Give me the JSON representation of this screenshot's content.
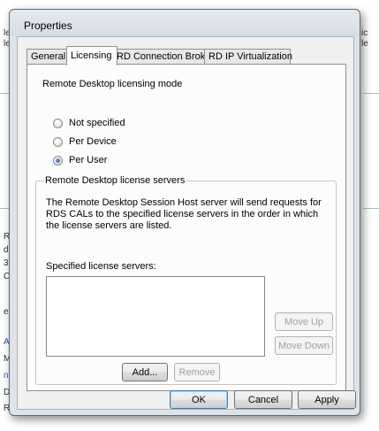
{
  "window": {
    "title": "Properties"
  },
  "tabs": [
    {
      "label": "General",
      "active": false
    },
    {
      "label": "Licensing",
      "active": true
    },
    {
      "label": "RD Connection Broker",
      "active": false
    },
    {
      "label": "RD IP Virtualization",
      "active": false
    }
  ],
  "licensing": {
    "mode_label": "Remote Desktop licensing mode",
    "modes": [
      {
        "label": "Not specified",
        "checked": false
      },
      {
        "label": "Per Device",
        "checked": false
      },
      {
        "label": "Per User",
        "checked": true
      }
    ],
    "servers_group": {
      "legend": "Remote Desktop license servers",
      "description": "The Remote Desktop Session Host server will send requests for RDS CALs to the specified license servers in the order in which the license servers are listed.",
      "list_label": "Specified license servers:",
      "servers": [],
      "move_up_label": "Move Up",
      "move_down_label": "Move Down",
      "add_label": "Add...",
      "remove_label": "Remove"
    }
  },
  "footer": {
    "ok_label": "OK",
    "cancel_label": "Cancel",
    "apply_label": "Apply"
  },
  "background_fragments": {
    "left": [
      "le",
      "le",
      "Re",
      "d",
      "3",
      "C",
      "e",
      "Ac",
      "M",
      "nt",
      "D",
      "Re"
    ],
    "right": [
      "ic",
      "le"
    ]
  }
}
